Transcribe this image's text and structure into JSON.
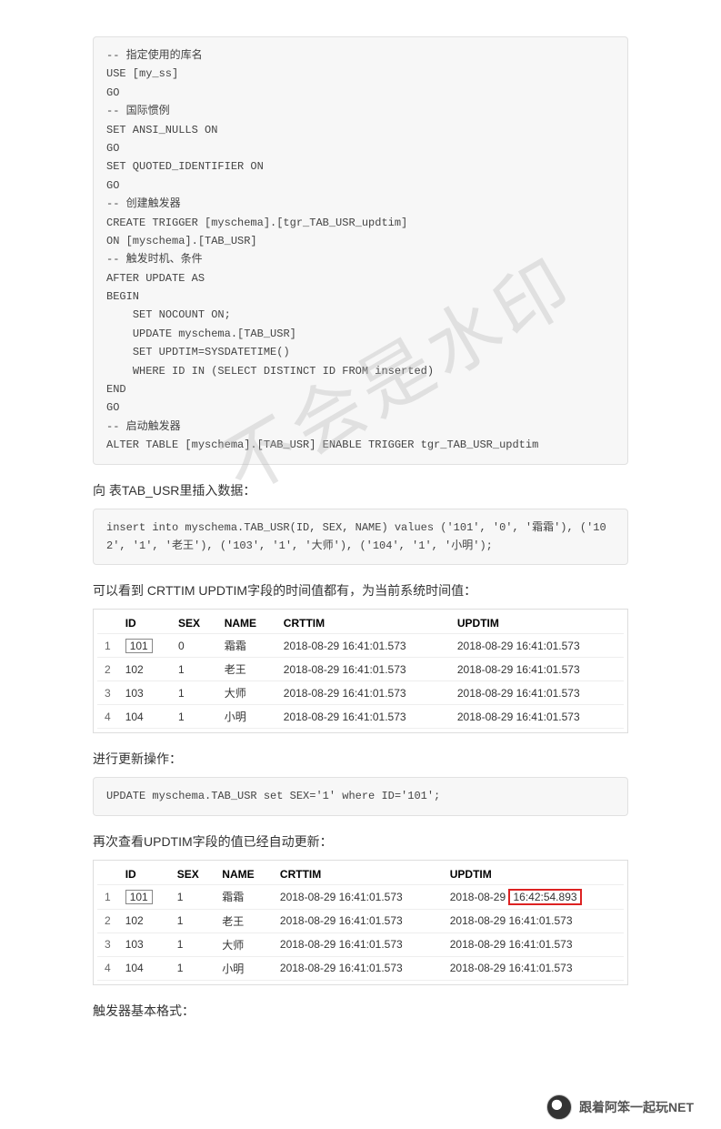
{
  "code1": "-- 指定使用的库名\nUSE [my_ss]\nGO\n-- 国际惯例\nSET ANSI_NULLS ON\nGO\nSET QUOTED_IDENTIFIER ON\nGO\n-- 创建触发器\nCREATE TRIGGER [myschema].[tgr_TAB_USR_updtim]\nON [myschema].[TAB_USR]\n-- 触发时机、条件\nAFTER UPDATE AS\nBEGIN\n    SET NOCOUNT ON;\n    UPDATE myschema.[TAB_USR]\n    SET UPDTIM=SYSDATETIME()\n    WHERE ID IN (SELECT DISTINCT ID FROM inserted)\nEND\nGO\n-- 启动触发器\nALTER TABLE [myschema].[TAB_USR] ENABLE TRIGGER tgr_TAB_USR_updtim",
  "desc1": "向 表TAB_USR里插入数据：",
  "code2": "insert into myschema.TAB_USR(ID, SEX, NAME) values ('101', '0', '霜霜'), ('102', '1', '老王'), ('103', '1', '大师'), ('104', '1', '小明');",
  "desc2": "可以看到 CRTTIM UPDTIM字段的时间值都有，为当前系统时间值：",
  "table1": {
    "headers": [
      "",
      "ID",
      "SEX",
      "NAME",
      "CRTTIM",
      "UPDTIM"
    ],
    "rows": [
      {
        "n": "1",
        "id": "101",
        "sex": "0",
        "name": "霜霜",
        "crt": "2018-08-29 16:41:01.573",
        "upd": "2018-08-29 16:41:01.573",
        "idbox": true
      },
      {
        "n": "2",
        "id": "102",
        "sex": "1",
        "name": "老王",
        "crt": "2018-08-29 16:41:01.573",
        "upd": "2018-08-29 16:41:01.573"
      },
      {
        "n": "3",
        "id": "103",
        "sex": "1",
        "name": "大师",
        "crt": "2018-08-29 16:41:01.573",
        "upd": "2018-08-29 16:41:01.573"
      },
      {
        "n": "4",
        "id": "104",
        "sex": "1",
        "name": "小明",
        "crt": "2018-08-29 16:41:01.573",
        "upd": "2018-08-29 16:41:01.573"
      }
    ]
  },
  "desc3": "进行更新操作：",
  "code3": "UPDATE myschema.TAB_USR set SEX='1' where ID='101';",
  "desc4": "再次查看UPDTIM字段的值已经自动更新：",
  "table2": {
    "headers": [
      "",
      "ID",
      "SEX",
      "NAME",
      "CRTTIM",
      "UPDTIM"
    ],
    "rows": [
      {
        "n": "1",
        "id": "101",
        "sex": "1",
        "name": "霜霜",
        "crt": "2018-08-29 16:41:01.573",
        "upd_pre": "2018-08-29 ",
        "upd_hl": "16:42:54.893",
        "idbox": true,
        "highlight": true
      },
      {
        "n": "2",
        "id": "102",
        "sex": "1",
        "name": "老王",
        "crt": "2018-08-29 16:41:01.573",
        "upd": "2018-08-29 16:41:01.573"
      },
      {
        "n": "3",
        "id": "103",
        "sex": "1",
        "name": "大师",
        "crt": "2018-08-29 16:41:01.573",
        "upd": "2018-08-29 16:41:01.573"
      },
      {
        "n": "4",
        "id": "104",
        "sex": "1",
        "name": "小明",
        "crt": "2018-08-29 16:41:01.573",
        "upd": "2018-08-29 16:41:01.573"
      }
    ]
  },
  "desc5": "触发器基本格式：",
  "watermark": "不会是水印",
  "footer": "跟着阿笨一起玩NET"
}
